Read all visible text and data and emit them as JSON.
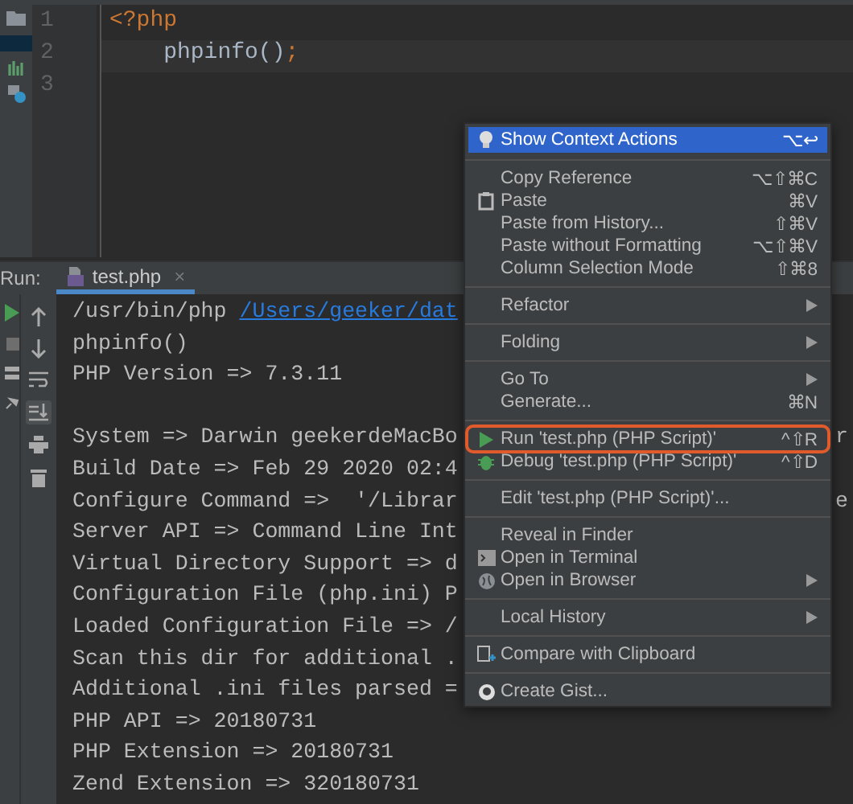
{
  "editor": {
    "lines": [
      {
        "number": "1",
        "tokens": [
          {
            "text": "<?php",
            "kind": "keyword"
          }
        ]
      },
      {
        "number": "2",
        "current": true,
        "tokens": [
          {
            "text": "    phpinfo()",
            "kind": "plain"
          },
          {
            "text": ";",
            "kind": "keyword"
          }
        ]
      },
      {
        "number": "3"
      }
    ]
  },
  "run_panel": {
    "label": "Run:",
    "tab": {
      "title": "test.php",
      "close": "×"
    },
    "console": [
      {
        "text": "/usr/bin/php ",
        "link": "/Users/geeker/dat"
      },
      {
        "text": "phpinfo()"
      },
      {
        "text": "PHP Version => 7.3.11"
      },
      {
        "text": "System => Darwin geekerdeMacBo",
        "tail": "r",
        "blank_line_before": true
      },
      {
        "text": "Build Date => Feb 29 2020 02:4"
      },
      {
        "text": "Configure Command =>  '/Librar",
        "tail": "e"
      },
      {
        "text": "Server API => Command Line Int"
      },
      {
        "text": "Virtual Directory Support => d"
      },
      {
        "text": "Configuration File (php.ini) P"
      },
      {
        "text": "Loaded Configuration File => /"
      },
      {
        "text": "Scan this dir for additional ."
      },
      {
        "text": "Additional .ini files parsed ="
      },
      {
        "text": "PHP API => 20180731"
      },
      {
        "text": "PHP Extension => 20180731"
      },
      {
        "text": "Zend Extension => 320180731"
      }
    ]
  },
  "context_menu": {
    "groups": [
      [
        {
          "label": "Show Context Actions",
          "shortcut": "⌥↩",
          "selected": true,
          "highlighted": false
        }
      ],
      [
        {
          "label": "Copy Reference",
          "shortcut": "⌥⇧⌘C",
          "selected": false,
          "highlighted": false
        },
        {
          "label": "Paste",
          "shortcut": "⌘V",
          "selected": false,
          "highlighted": false
        },
        {
          "label": "Paste from History...",
          "shortcut": "⇧⌘V",
          "selected": false,
          "highlighted": false
        },
        {
          "label": "Paste without Formatting",
          "shortcut": "⌥⇧⌘V",
          "selected": false,
          "highlighted": false
        },
        {
          "label": "Column Selection Mode",
          "shortcut": "⇧⌘8",
          "selected": false,
          "highlighted": false
        }
      ],
      [
        {
          "label": "Refactor",
          "submenu": true,
          "selected": false,
          "highlighted": false
        }
      ],
      [
        {
          "label": "Folding",
          "submenu": true,
          "selected": false,
          "highlighted": false
        }
      ],
      [
        {
          "label": "Go To",
          "submenu": true,
          "selected": false,
          "highlighted": false
        },
        {
          "label": "Generate...",
          "shortcut": "⌘N",
          "selected": false,
          "highlighted": false
        }
      ],
      [
        {
          "label": "Run 'test.php (PHP Script)'",
          "shortcut": "^⇧R",
          "selected": false,
          "highlighted": true
        },
        {
          "label": "Debug 'test.php (PHP Script)'",
          "shortcut": "^⇧D",
          "selected": false,
          "highlighted": false
        }
      ],
      [
        {
          "label": "Edit 'test.php (PHP Script)'...",
          "selected": false,
          "highlighted": false
        }
      ],
      [
        {
          "label": "Reveal in Finder",
          "selected": false,
          "highlighted": false
        },
        {
          "label": "Open in Terminal",
          "selected": false,
          "highlighted": false
        },
        {
          "label": "Open in Browser",
          "submenu": true,
          "selected": false,
          "highlighted": false
        }
      ],
      [
        {
          "label": "Local History",
          "submenu": true,
          "selected": false,
          "highlighted": false
        }
      ],
      [
        {
          "label": "Compare with Clipboard",
          "selected": false,
          "highlighted": false
        }
      ],
      [
        {
          "label": "Create Gist...",
          "selected": false,
          "highlighted": false
        }
      ]
    ]
  }
}
